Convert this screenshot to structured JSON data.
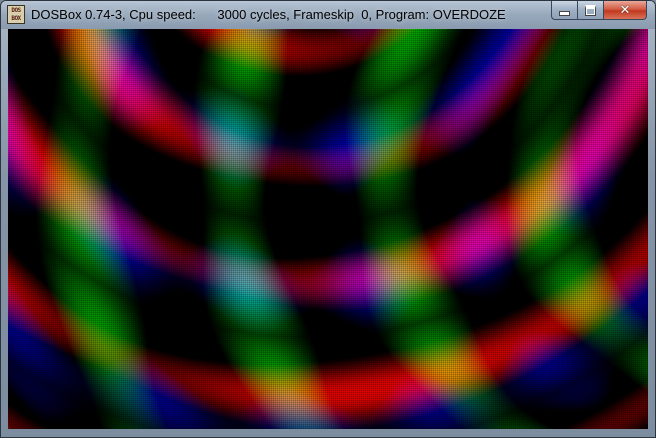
{
  "window": {
    "title": "DOSBox 0.74-3, Cpu speed:      3000 cycles, Frameskip  0, Program: OVERDOZE",
    "icon": {
      "name": "dosbox-icon",
      "line1": "DOS",
      "line2": "BOX"
    },
    "controls": {
      "minimize_icon": "minimize-icon",
      "maximize_icon": "maximize-icon",
      "close_icon": "close-icon",
      "close_glyph": "✕"
    }
  },
  "screen": {
    "program": "OVERDOZE",
    "effect": "plasma interference pattern",
    "palette": {
      "red": "#ff1a1a",
      "green": "#33dd22",
      "blue": "#3322ee",
      "magenta": "#e01060",
      "black": "#000000"
    }
  }
}
